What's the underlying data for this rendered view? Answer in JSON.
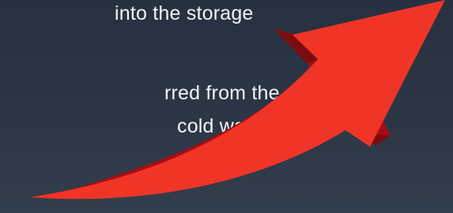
{
  "text_lines": [
    "into the storage",
    "rred from the",
    "cold water."
  ],
  "arrow": {
    "icon": "curved-up-right-arrow-icon",
    "color_front": "#f03527",
    "color_side": "#a90d12",
    "color_shadow": "#7d0c0f"
  },
  "background": {
    "top": "#283140",
    "bottom": "#333e4c"
  }
}
